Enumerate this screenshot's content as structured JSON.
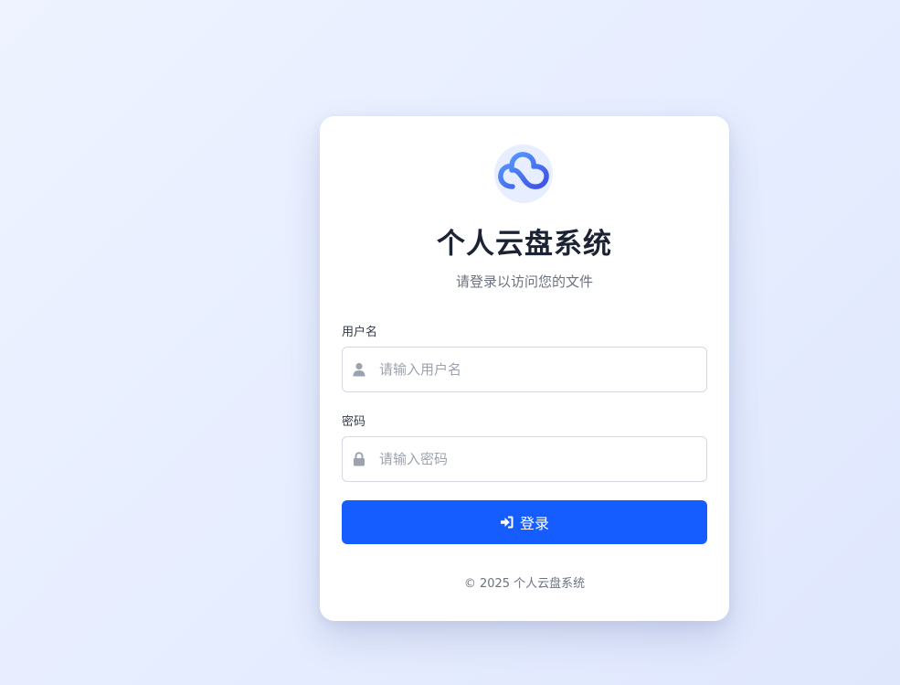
{
  "login": {
    "title": "个人云盘系统",
    "subtitle": "请登录以访问您的文件",
    "username_label": "用户名",
    "username_placeholder": "请输入用户名",
    "password_label": "密码",
    "password_placeholder": "请输入密码",
    "submit_label": "登录",
    "footer": "© 2025 个人云盘系统"
  },
  "icons": {
    "logo": "cloud-icon",
    "username": "user-icon",
    "password": "lock-icon",
    "submit": "sign-in-icon"
  },
  "colors": {
    "primary": "#165dff",
    "logo_bg": "#e6eeff",
    "title": "#1c2333",
    "muted": "#6b7280"
  }
}
